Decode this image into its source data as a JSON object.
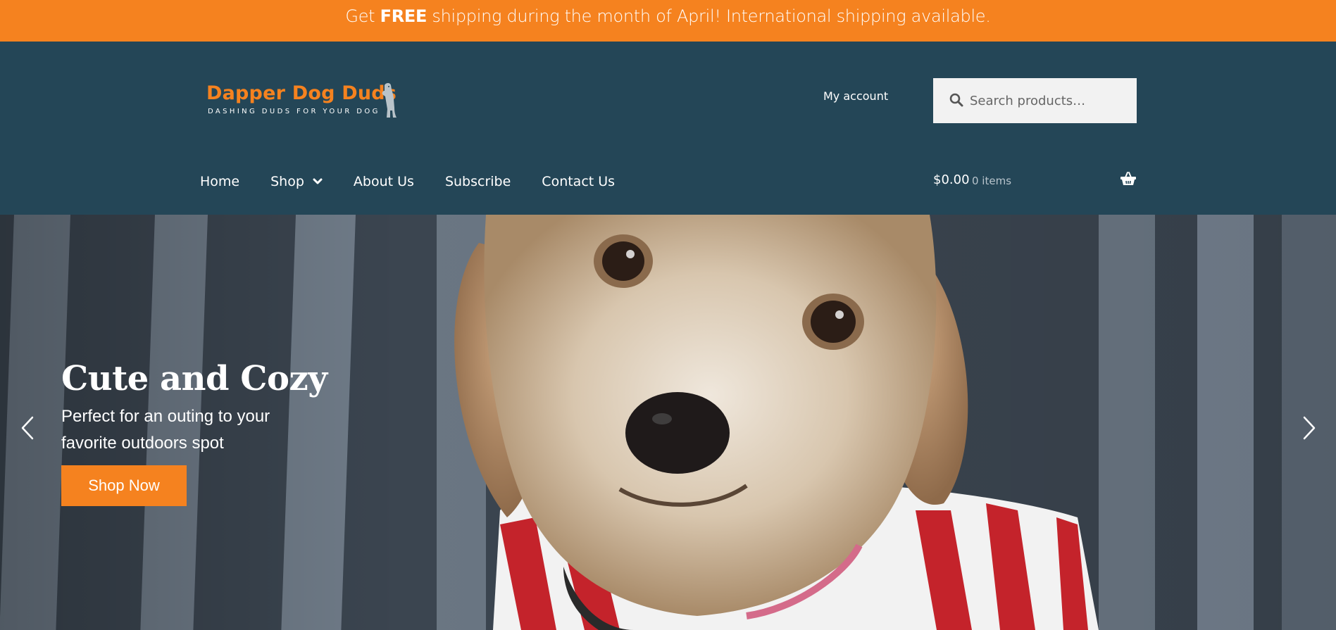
{
  "topbar": {
    "prefix": "Get ",
    "bold": "FREE",
    "suffix": " shipping during the month of April! International shipping available."
  },
  "header": {
    "logo_title": "Dapper Dog Duds",
    "logo_tagline": "DASHING DUDS FOR YOUR DOG",
    "my_account": "My account",
    "search_placeholder": "Search products…"
  },
  "nav": {
    "items": [
      {
        "label": "Home"
      },
      {
        "label": "Shop",
        "has_dropdown": true
      },
      {
        "label": "About Us"
      },
      {
        "label": "Subscribe"
      },
      {
        "label": "Contact Us"
      }
    ]
  },
  "cart": {
    "amount": "$0.00",
    "items": "0 items"
  },
  "hero": {
    "title": "Cute and Cozy",
    "subtitle": "Perfect for an outing to your favorite outdoors spot",
    "button": "Shop Now"
  },
  "colors": {
    "accent": "#f5821f",
    "header_bg": "#244657"
  },
  "icons": [
    "dog-silhouette-icon",
    "search-icon",
    "chevron-down-icon",
    "basket-icon",
    "chevron-left-icon",
    "chevron-right-icon"
  ]
}
